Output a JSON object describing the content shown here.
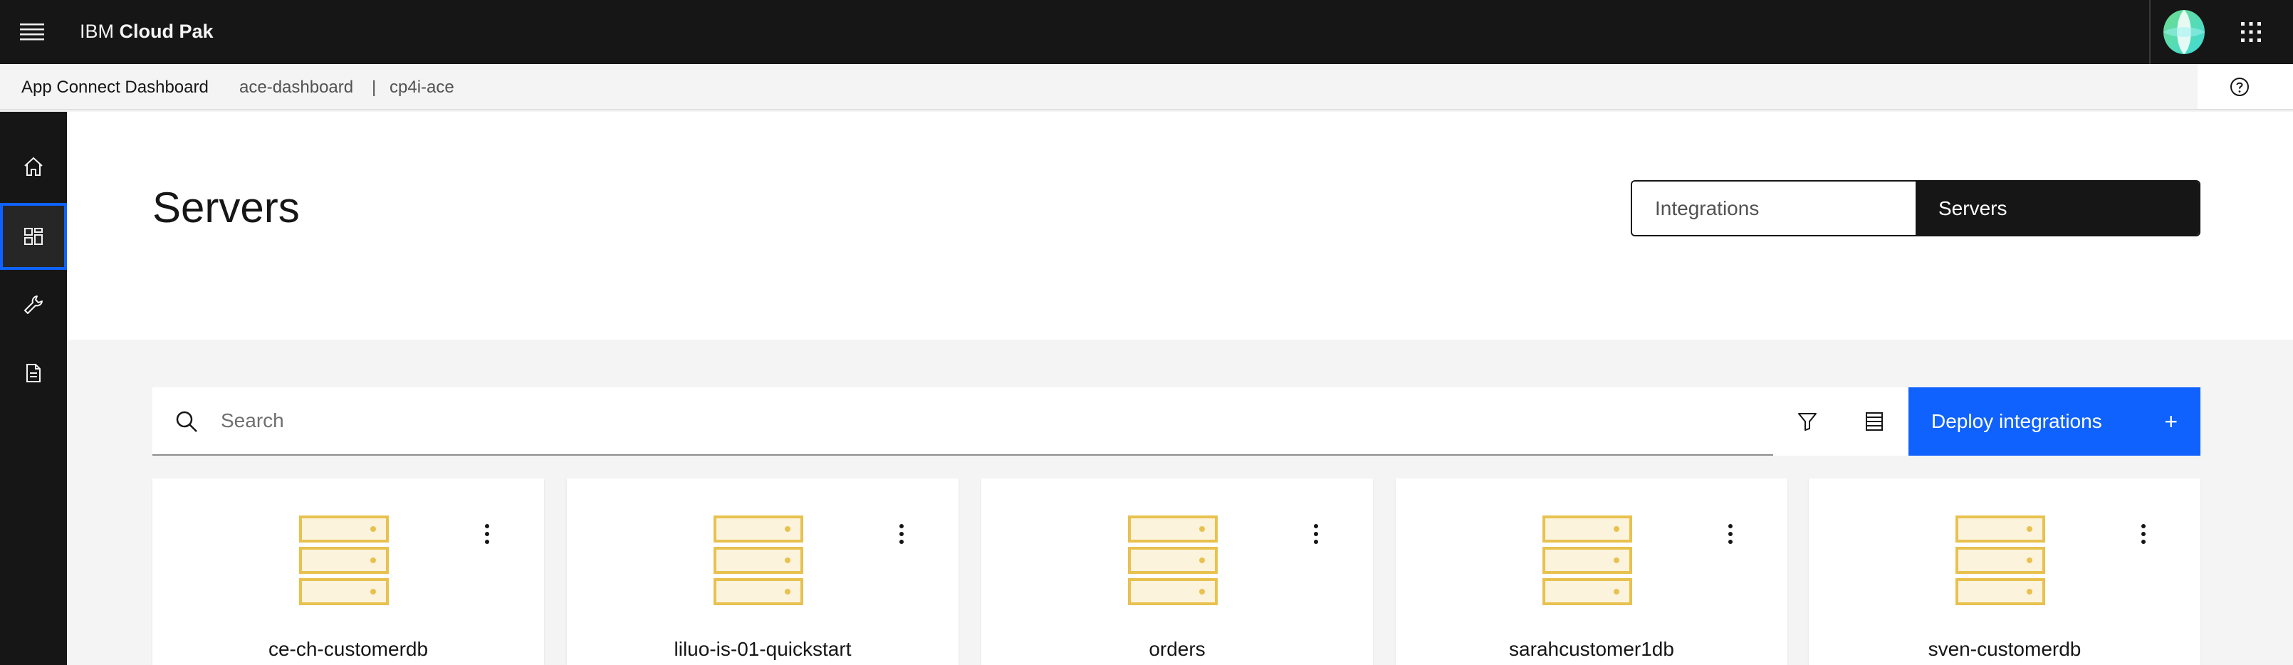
{
  "header": {
    "brand_prefix": "IBM",
    "brand_product": "Cloud Pak",
    "icons": {
      "menu": "hamburger-menu-icon",
      "avatar": "user-avatar-icon",
      "switcher": "app-switcher-grid-icon"
    }
  },
  "breadcrumb": {
    "app": "App Connect Dashboard",
    "namespace": "ace-dashboard",
    "separator": "|",
    "instance": "cp4i-ace",
    "help_icon": "help-icon"
  },
  "nav": {
    "items": [
      {
        "name": "home",
        "icon": "home-icon"
      },
      {
        "name": "dashboard",
        "icon": "dashboard-icon",
        "active": true
      },
      {
        "name": "tools",
        "icon": "wrench-icon"
      },
      {
        "name": "documents",
        "icon": "document-icon"
      }
    ]
  },
  "main": {
    "title": "Servers",
    "view_switcher": {
      "options": [
        "Integrations",
        "Servers"
      ],
      "selected": "Servers"
    },
    "search": {
      "placeholder": "Search",
      "value": ""
    },
    "toolbar": {
      "filter_icon": "filter-icon",
      "view_icon": "list-view-icon",
      "deploy_label": "Deploy integrations",
      "deploy_icon": "+"
    },
    "servers": [
      {
        "name": "ce-ch-customerdb"
      },
      {
        "name": "liluo-is-01-quickstart"
      },
      {
        "name": "orders"
      },
      {
        "name": "sarahcustomer1db"
      },
      {
        "name": "sven-customerdb"
      }
    ]
  },
  "colors": {
    "shell": "#161616",
    "accent": "#0f62fe",
    "server_icon_stroke": "#e8c14e",
    "server_icon_fill": "#fbf3dc"
  }
}
